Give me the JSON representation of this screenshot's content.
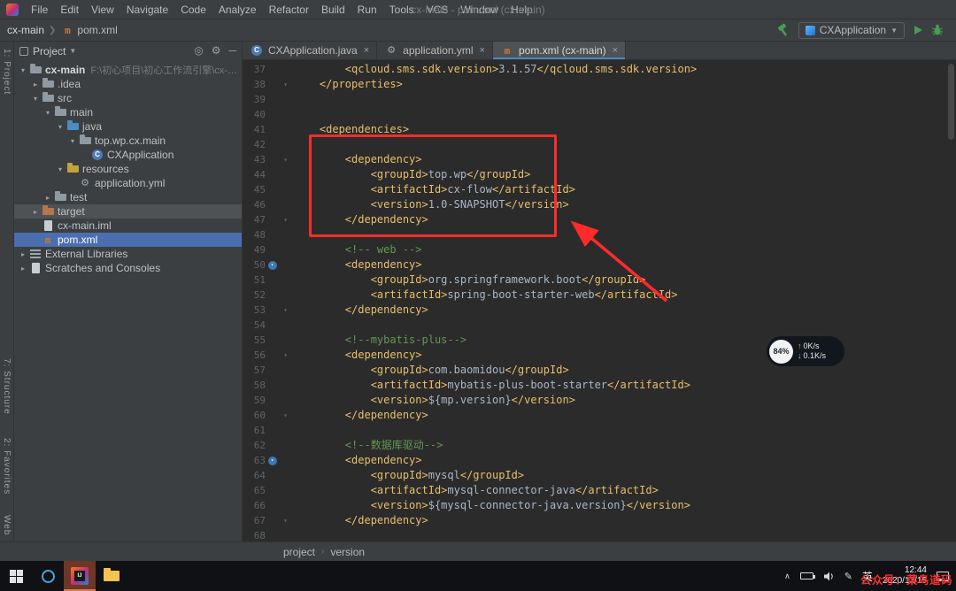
{
  "window": {
    "title": "cx-main - pom.xml (cx-main)"
  },
  "menu_bar": {
    "items": [
      "File",
      "Edit",
      "View",
      "Navigate",
      "Code",
      "Analyze",
      "Refactor",
      "Build",
      "Run",
      "Tools",
      "VCS",
      "Window",
      "Help"
    ]
  },
  "toolbar": {
    "breadcrumb_project": "cx-main",
    "breadcrumb_file": "pom.xml",
    "run_config": "CXApplication"
  },
  "tool_strip": {
    "project": "1: Project",
    "structure": "7: Structure",
    "favorites": "2: Favorites",
    "web": "Web"
  },
  "project_panel": {
    "title": "Project",
    "header_icons": [
      "locate",
      "settings",
      "hide"
    ],
    "tree": [
      {
        "label": "cx-main",
        "hint": "F:\\初心项目\\初心工作流引擎\\cx-main",
        "icon": "folder",
        "depth": 0,
        "arrow": "down",
        "bold": true
      },
      {
        "label": ".idea",
        "icon": "folder",
        "depth": 1,
        "arrow": "right"
      },
      {
        "label": "src",
        "icon": "folder",
        "depth": 1,
        "arrow": "down"
      },
      {
        "label": "main",
        "icon": "folder",
        "depth": 2,
        "arrow": "down"
      },
      {
        "label": "java",
        "icon": "folder-java",
        "depth": 3,
        "arrow": "down"
      },
      {
        "label": "top.wp.cx.main",
        "icon": "package",
        "depth": 4,
        "arrow": "down"
      },
      {
        "label": "CXApplication",
        "icon": "class",
        "depth": 5,
        "arrow": "none"
      },
      {
        "label": "resources",
        "icon": "folder-res",
        "depth": 3,
        "arrow": "down"
      },
      {
        "label": "application.yml",
        "icon": "yml",
        "depth": 4,
        "arrow": "none"
      },
      {
        "label": "test",
        "icon": "folder",
        "depth": 2,
        "arrow": "right"
      },
      {
        "label": "target",
        "icon": "folder-excl",
        "depth": 1,
        "arrow": "right",
        "sel": "gray"
      },
      {
        "label": "cx-main.iml",
        "icon": "file",
        "depth": 1,
        "arrow": "none"
      },
      {
        "label": "pom.xml",
        "icon": "maven",
        "depth": 1,
        "arrow": "none",
        "sel": "blue"
      },
      {
        "label": "External Libraries",
        "icon": "lib",
        "depth": 0,
        "arrow": "right"
      },
      {
        "label": "Scratches and Consoles",
        "icon": "scratch",
        "depth": 0,
        "arrow": "right"
      }
    ]
  },
  "editor": {
    "tabs": [
      {
        "label": "CXApplication.java",
        "icon": "class",
        "close": "×"
      },
      {
        "label": "application.yml",
        "icon": "yml",
        "close": "×"
      },
      {
        "label": "pom.xml (cx-main)",
        "icon": "maven",
        "close": "×",
        "active": true
      }
    ],
    "lines": [
      {
        "n": 37,
        "t": "        <qcloud.sms.sdk.version>3.1.57</qcloud.sms.sdk.version>"
      },
      {
        "n": 38,
        "t": "    </properties>",
        "fold": true
      },
      {
        "n": 39,
        "t": ""
      },
      {
        "n": 40,
        "t": ""
      },
      {
        "n": 41,
        "t": "    <dependencies>"
      },
      {
        "n": 42,
        "t": ""
      },
      {
        "n": 43,
        "t": "        <dependency>",
        "fold": true
      },
      {
        "n": 44,
        "t": "            <groupId>top.wp</groupId>"
      },
      {
        "n": 45,
        "t": "            <artifactId>cx-flow</artifactId>"
      },
      {
        "n": 46,
        "t": "            <version>1.0-SNAPSHOT</version>"
      },
      {
        "n": 47,
        "t": "        </dependency>",
        "fold": true
      },
      {
        "n": 48,
        "t": ""
      },
      {
        "n": 49,
        "t": "        <!-- web -->"
      },
      {
        "n": 50,
        "t": "        <dependency>",
        "maven": true
      },
      {
        "n": 51,
        "t": "            <groupId>org.springframework.boot</groupId>"
      },
      {
        "n": 52,
        "t": "            <artifactId>spring-boot-starter-web</artifactId>"
      },
      {
        "n": 53,
        "t": "        </dependency>",
        "fold": true
      },
      {
        "n": 54,
        "t": ""
      },
      {
        "n": 55,
        "t": "        <!--mybatis-plus-->"
      },
      {
        "n": 56,
        "t": "        <dependency>",
        "fold": true
      },
      {
        "n": 57,
        "t": "            <groupId>com.baomidou</groupId>"
      },
      {
        "n": 58,
        "t": "            <artifactId>mybatis-plus-boot-starter</artifactId>"
      },
      {
        "n": 59,
        "t": "            <version>${mp.version}</version>"
      },
      {
        "n": 60,
        "t": "        </dependency>",
        "fold": true
      },
      {
        "n": 61,
        "t": ""
      },
      {
        "n": 62,
        "t": "        <!--数据库驱动-->"
      },
      {
        "n": 63,
        "t": "        <dependency>",
        "maven": true
      },
      {
        "n": 64,
        "t": "            <groupId>mysql</groupId>"
      },
      {
        "n": 65,
        "t": "            <artifactId>mysql-connector-java</artifactId>"
      },
      {
        "n": 66,
        "t": "            <version>${mysql-connector-java.version}</version>"
      },
      {
        "n": 67,
        "t": "        </dependency>",
        "fold": true
      },
      {
        "n": 68,
        "t": ""
      }
    ],
    "bottom_breadcrumb": [
      "project",
      "version"
    ]
  },
  "perf_widget": {
    "percent": "84%",
    "up": "0K/s",
    "down": "0.1K/s"
  },
  "taskbar": {
    "ime": "英",
    "time": "12:44",
    "date": "2020/12/15",
    "watermark": "公众号：菜鸟道码"
  },
  "colors": {
    "accent_blue": "#4A88C7",
    "selection_blue": "#4b6eaf",
    "annotation_red": "#ff2b2b",
    "run_green": "#499C54",
    "tag_yellow": "#e8bf6a",
    "comment_green": "#629755"
  }
}
